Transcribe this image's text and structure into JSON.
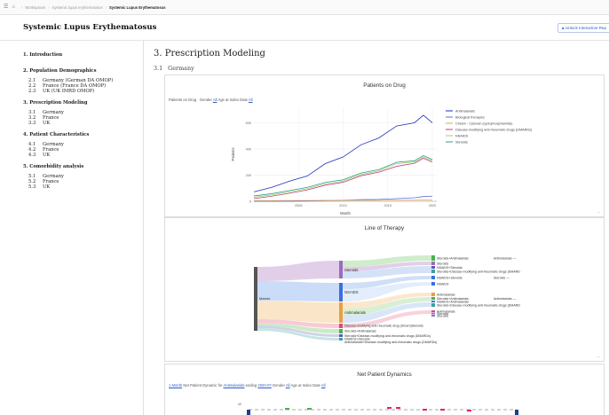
{
  "breadcrumb": {
    "menu_icon": "menu-icon",
    "home_icon": "home-icon",
    "items": [
      "Workspaces",
      "Systemic lupus erythematosus",
      "Systemic Lupus Erythematosus"
    ]
  },
  "header": {
    "title": "Systemic Lupus Erythematosus",
    "unlock_label": "Unlock Interactive Rep"
  },
  "sidebar": {
    "sections": [
      {
        "label": "1. Introduction",
        "items": []
      },
      {
        "label": "2. Population Demographics",
        "items": [
          {
            "num": "2.1",
            "label": "Germany (German DA OMOP)"
          },
          {
            "num": "2.2",
            "label": "France (France DA OMOP)"
          },
          {
            "num": "2.3",
            "label": "UK (UK IMRD OMOP)"
          }
        ]
      },
      {
        "label": "3. Prescription Modeling",
        "items": [
          {
            "num": "3.1",
            "label": "Germany"
          },
          {
            "num": "3.2",
            "label": "France"
          },
          {
            "num": "3.3",
            "label": "UK"
          }
        ]
      },
      {
        "label": "4. Patient Characteristics",
        "items": [
          {
            "num": "4.1",
            "label": "Germany"
          },
          {
            "num": "4.2",
            "label": "France"
          },
          {
            "num": "4.3",
            "label": "UK"
          }
        ]
      },
      {
        "label": "5. Comorbidity analysis",
        "items": [
          {
            "num": "5.1",
            "label": "Germany"
          },
          {
            "num": "5.2",
            "label": "France"
          },
          {
            "num": "5.3",
            "label": "UK"
          }
        ]
      }
    ]
  },
  "main": {
    "section_title": "3. Prescription Modeling",
    "subsection_num": "3.1",
    "subsection_label": "Germany"
  },
  "patients_on_drug": {
    "title": "Patients on Drug",
    "filter_prefix": "Patients on Drug · Gender",
    "gender": "All",
    "age_prefix": "Age at Index Date",
    "age": "All"
  },
  "line_of_therapy": {
    "title": "Line of Therapy",
    "labels": {
      "start": "Market",
      "steroids": "Steroids",
      "nsaids": "NSAIDS",
      "antimalarials": "Antimalarials",
      "dmard_mid": "Disease-modifying anti-rheumatic drug (Dmard)Steroids",
      "ster_anti_mid": "Steroids+Antimalarials",
      "combo_mid": "Steroids+Disease-modifying anti-rheumatic drugs (DMARDs)",
      "nsaid_ster_mid": "NSAIDS+Steroids",
      "anti_dmard_mid": "Antimalarials+Disease-modifying anti-rheumatic drugs (DMARDs)",
      "r1": "Steroids+Antimalarials",
      "r1b": "Antimalarials",
      "r2": "Steroids",
      "r3": "NSAIDS+Steroids",
      "r4": "Steroids+Disease-modifying anti-rheumatic drugs (DMARD",
      "r5": "NSAIDS+Steroids",
      "r5b": "Steroids",
      "r6": "NSAIDS",
      "r7": "Antimalarials",
      "r8": "Steroids+Antimalarials",
      "r8b": "Antimalarials",
      "r9": "NSAIDS+Antimalarials",
      "r10": "Steroids+Disease-modifying anti-rheumatic drugs (DMARD",
      "r11": "Antimalarials",
      "r12": "Steroids",
      "r13": "Steroids"
    }
  },
  "net_patient_dynamics": {
    "title": "Net Patient Dynamics",
    "period": "1 Month",
    "prefix": "Net Patient Dynamic for",
    "drug": "Antimalarials",
    "ending_label": "ending",
    "ending": "2020-07",
    "gender_label": "Gender",
    "gender": "All",
    "age_label": "Age at Index Date",
    "age": "All",
    "y_tick": "40"
  },
  "chart_data": {
    "type": "line",
    "title": "Patients on Drug",
    "xlabel": "Month",
    "ylabel": "Patients",
    "x": [
      2000,
      2002,
      2004,
      2006,
      2008,
      2010,
      2012,
      2014,
      2016,
      2018,
      2019,
      2020
    ],
    "xticks": [
      "2005",
      "2010",
      "2015",
      "2020"
    ],
    "yticks": [
      0,
      200,
      400,
      600
    ],
    "ylim": [
      0,
      720
    ],
    "xlim": [
      2000,
      2020.5
    ],
    "legend_position": "right",
    "series": [
      {
        "name": "Antimalarials",
        "color": "#1f2fb8",
        "values": [
          70,
          110,
          150,
          200,
          280,
          350,
          420,
          500,
          560,
          620,
          640,
          620
        ]
      },
      {
        "name": "Biological therapies",
        "color": "#5b6fd8",
        "values": [
          0,
          0,
          0,
          2,
          5,
          8,
          12,
          15,
          20,
          28,
          35,
          40
        ]
      },
      {
        "name": "Chelon - Cytoxan (cyclophosphamide)",
        "color": "#e6a24a",
        "values": [
          5,
          5,
          6,
          6,
          7,
          7,
          8,
          8,
          8,
          9,
          9,
          9
        ]
      },
      {
        "name": "Disease-modifying anti-rheumatic drugs (DMARDs)",
        "color": "#c2407a",
        "values": [
          20,
          40,
          60,
          90,
          120,
          150,
          190,
          230,
          260,
          300,
          320,
          310
        ]
      },
      {
        "name": "NSAIDS",
        "color": "#9fd06a",
        "values": [
          30,
          50,
          70,
          100,
          130,
          160,
          200,
          240,
          280,
          310,
          330,
          320
        ]
      },
      {
        "name": "Steroids",
        "color": "#2e9c8e",
        "values": [
          40,
          60,
          80,
          110,
          140,
          170,
          210,
          250,
          290,
          320,
          340,
          330
        ]
      }
    ]
  }
}
